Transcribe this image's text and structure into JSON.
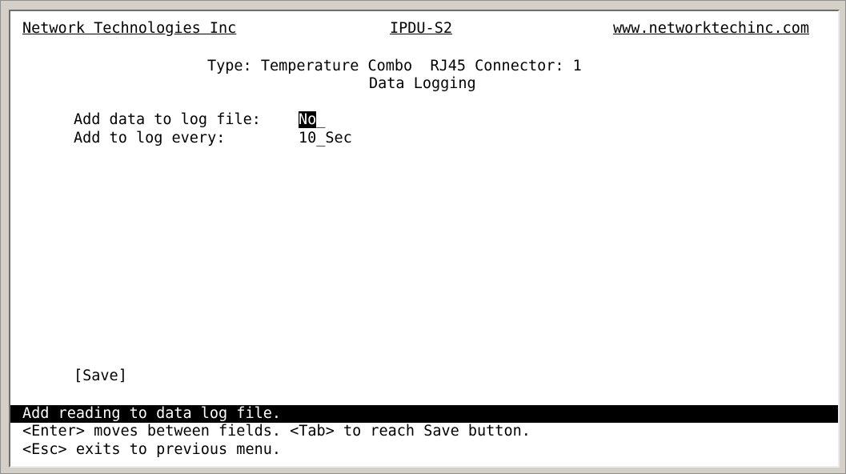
{
  "header": {
    "company": "Network Technologies Inc",
    "model": "IPDU-S2",
    "website": "www.networktechinc.com"
  },
  "subheader": {
    "type_line": "Type: Temperature Combo  RJ45 Connector: 1",
    "screen_title": "Data Logging"
  },
  "fields": [
    {
      "label": "Add data to log file:",
      "value_highlight": "No",
      "value_rest": "_"
    },
    {
      "label": "Add to log every:",
      "value": "10_Sec"
    }
  ],
  "save_button": "[Save]",
  "status": {
    "message": "Add reading to data log file.",
    "help1": "<Enter> moves between fields. <Tab> to reach Save button.",
    "help2": "<Esc> exits to previous menu."
  }
}
